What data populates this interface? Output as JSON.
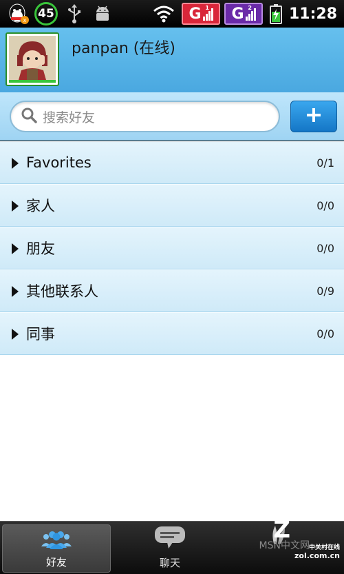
{
  "status_bar": {
    "battery_level_text": "45",
    "network1_label": "G",
    "network1_sup": "1",
    "network2_label": "G",
    "network2_sup": "2",
    "time": "11:28",
    "icons": [
      "qq-icon",
      "usb-icon",
      "android-debug-icon",
      "wifi-icon",
      "battery-charging-icon"
    ]
  },
  "profile": {
    "username": "panpan  (在线)"
  },
  "search": {
    "placeholder": "搜索好友",
    "add_button_icon": "plus-icon"
  },
  "groups": [
    {
      "label": "Favorites",
      "count": "0/1"
    },
    {
      "label": "家人",
      "count": "0/0"
    },
    {
      "label": "朋友",
      "count": "0/0"
    },
    {
      "label": "其他联系人",
      "count": "0/9"
    },
    {
      "label": "同事",
      "count": "0/0"
    }
  ],
  "tabs": [
    {
      "label": "好友",
      "icon": "friends-icon",
      "active": true
    },
    {
      "label": "聊天",
      "icon": "chat-bubble-icon",
      "active": false
    }
  ],
  "watermark": {
    "cn": "中关村在线",
    "domain": "zol.com.cn",
    "sub": "MSN中文网"
  },
  "colors": {
    "header_blue": "#4aa8e0",
    "row_blue": "#cfeaf8",
    "accent_button": "#1476c6",
    "online_green": "#39c53b"
  }
}
